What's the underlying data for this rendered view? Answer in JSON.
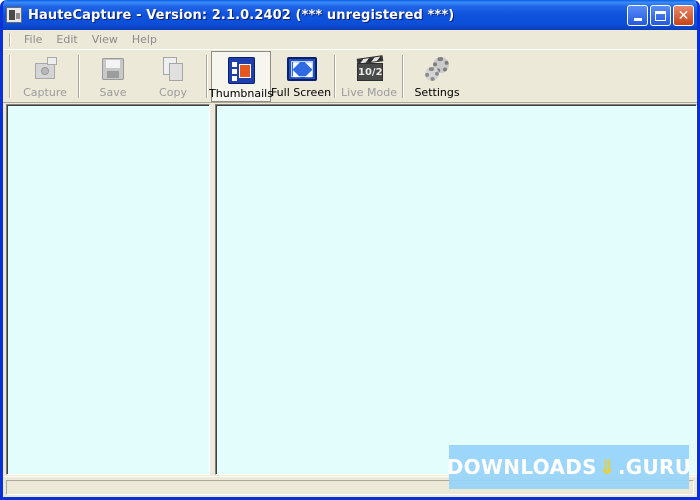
{
  "window": {
    "title": "HauteCapture - Version: 2.1.0.2402  (*** unregistered ***)",
    "min_label": "_",
    "max_label": "□",
    "close_label": "✕"
  },
  "menu": {
    "items": [
      {
        "label": "File"
      },
      {
        "label": "Edit"
      },
      {
        "label": "View"
      },
      {
        "label": "Help"
      }
    ]
  },
  "toolbar": {
    "capture_label": "Capture",
    "save_label": "Save",
    "copy_label": "Copy",
    "thumbnails_label": "Thumbnails",
    "fullscreen_label": "Full Screen",
    "livemode_label": "Live Mode",
    "livemode_board": "10/2",
    "settings_label": "Settings"
  },
  "colors": {
    "pane_background": "#e3fdfd",
    "chrome": "#ece9d8",
    "titlebar": "#0f52dc"
  },
  "watermark": {
    "left": "DOWNLOADS",
    "right": ".GURU"
  }
}
